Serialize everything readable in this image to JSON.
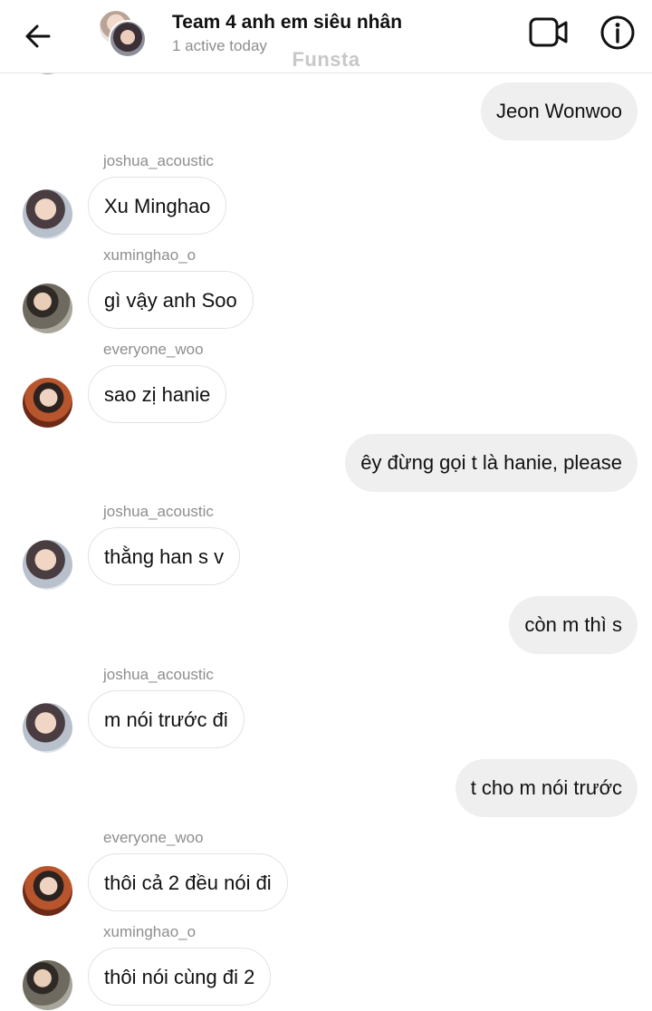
{
  "header": {
    "title": "Team 4 anh em siêu nhân",
    "status": "1 active today"
  },
  "watermark": "Funsta",
  "messages": [
    {
      "direction": "out",
      "text": "Jeon Wonwoo"
    },
    {
      "direction": "in",
      "sender": "joshua_acoustic",
      "avatar": "joshua-avatar",
      "text": "Xu Minghao"
    },
    {
      "direction": "in",
      "sender": "xuminghao_o",
      "avatar": "xuminghao-avatar",
      "text": "gì vậy anh Soo"
    },
    {
      "direction": "in",
      "sender": "everyone_woo",
      "avatar": "woo-avatar",
      "text": "sao zị hanie"
    },
    {
      "direction": "out",
      "text": "êy đừng gọi t là hanie,  please"
    },
    {
      "direction": "in",
      "sender": "joshua_acoustic",
      "avatar": "joshua-avatar",
      "text": "thằng han s v"
    },
    {
      "direction": "out",
      "text": "còn m thì s"
    },
    {
      "direction": "in",
      "sender": "joshua_acoustic",
      "avatar": "joshua-avatar",
      "text": "m nói trước đi"
    },
    {
      "direction": "out",
      "text": "t cho m nói trước"
    },
    {
      "direction": "in",
      "sender": "everyone_woo",
      "avatar": "woo-avatar",
      "text": "thôi cả 2 đều nói đi"
    },
    {
      "direction": "in",
      "sender": "xuminghao_o",
      "avatar": "xuminghao-avatar",
      "text": "thôi nói cùng đi 2"
    }
  ],
  "icons": {
    "back": "arrow-left-icon",
    "video": "video-camera-icon",
    "info": "info-icon"
  }
}
